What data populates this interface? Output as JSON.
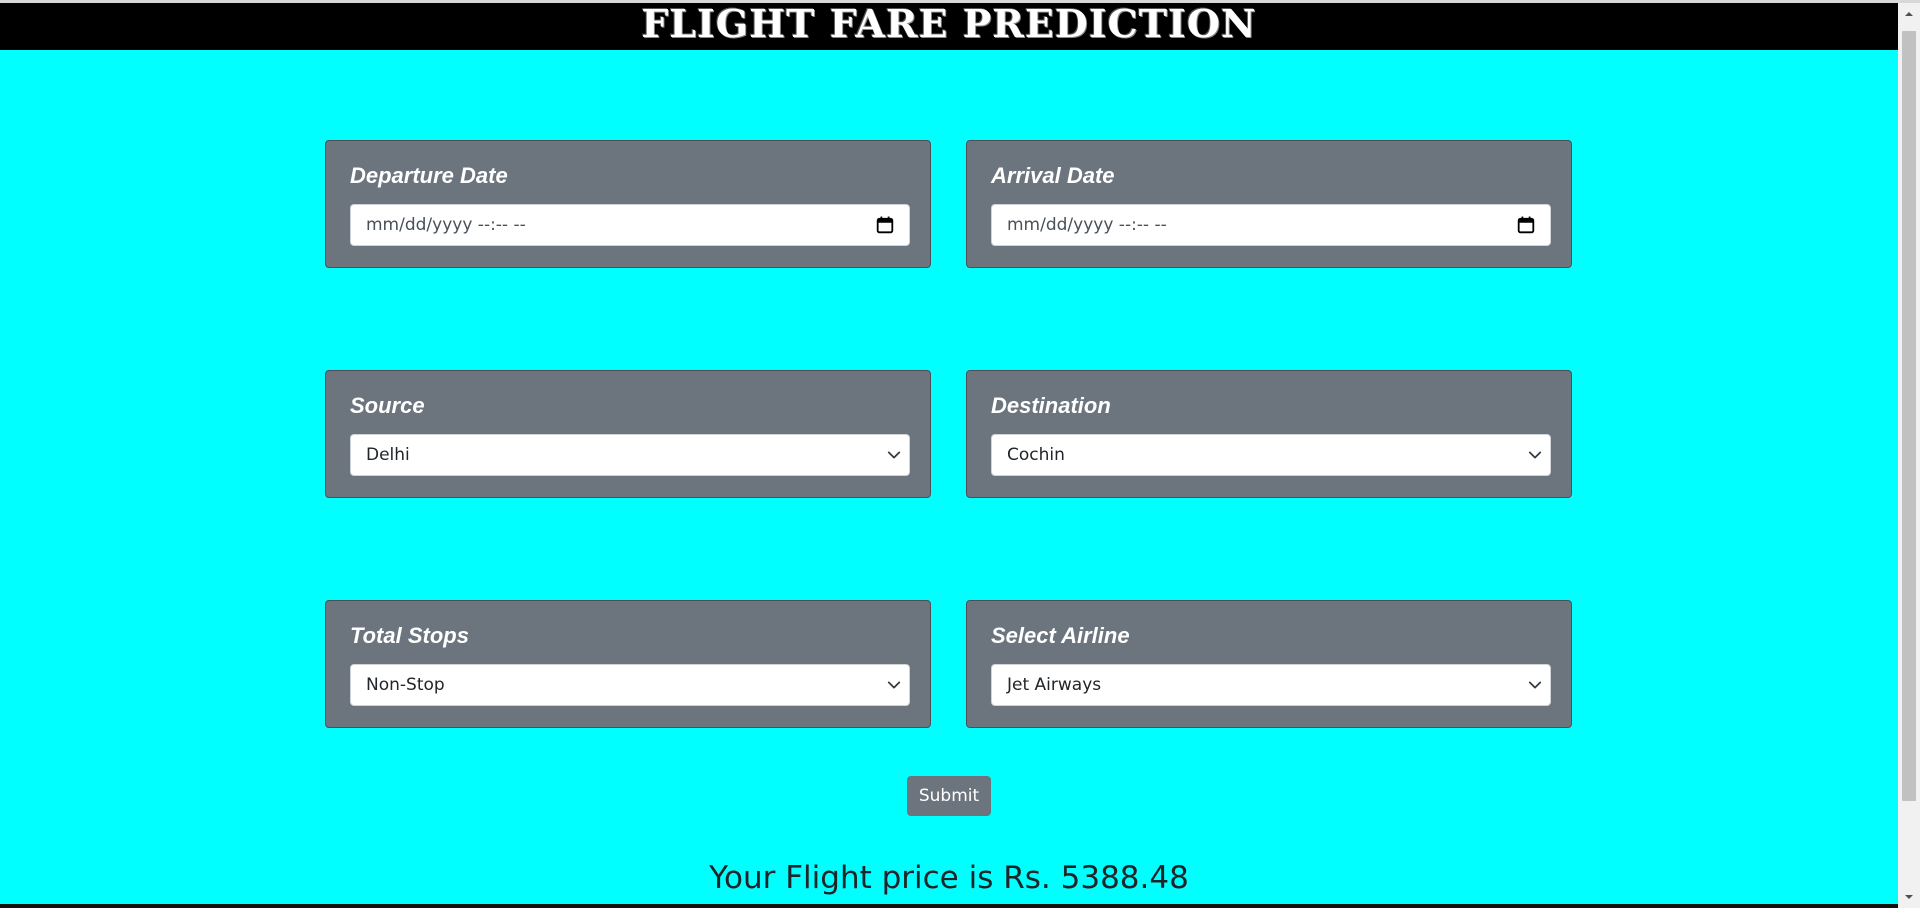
{
  "header": {
    "title": "FLIGHT FARE PREDICTION"
  },
  "form": {
    "departure": {
      "label": "Departure Date",
      "placeholder": "mm/dd/yyyy --:-- --"
    },
    "arrival": {
      "label": "Arrival Date",
      "placeholder": "mm/dd/yyyy --:-- --"
    },
    "source": {
      "label": "Source",
      "selected": "Delhi"
    },
    "destination": {
      "label": "Destination",
      "selected": "Cochin"
    },
    "stops": {
      "label": "Total Stops",
      "selected": "Non-Stop"
    },
    "airline": {
      "label": "Select Airline",
      "selected": "Jet Airways"
    },
    "submit_label": "Submit"
  },
  "result": {
    "text": "Your Flight price is Rs. 5388.48"
  },
  "icons": {
    "calendar": "calendar-icon",
    "dropdown": "chevron-down-icon",
    "scroll_up": "arrow-up-icon",
    "scroll_down": "arrow-down-icon"
  },
  "colors": {
    "page_background": "#00ffff",
    "header_background": "#000000",
    "card_background": "#6c757d",
    "button_background": "#6c757d"
  }
}
